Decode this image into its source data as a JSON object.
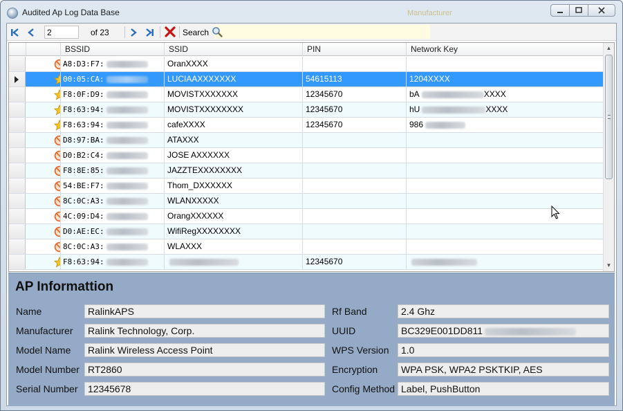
{
  "window": {
    "title": "Audited Ap Log Data Base",
    "ghost_title": "Manufacturer"
  },
  "toolbar": {
    "page_value": "2",
    "of_label": "of 23",
    "search_label": "Search"
  },
  "grid": {
    "columns": [
      "BSSID",
      "SSID",
      "PIN",
      "Network Key"
    ],
    "rows": [
      {
        "status": "blocked",
        "bssid": "A8:D3:F7:",
        "ssid": "OranXXXX",
        "pin": "",
        "key": "",
        "selected": false,
        "bssid_blur": 60,
        "ssid_blur": 0,
        "key_blur": 0
      },
      {
        "status": "star",
        "bssid": "00:05:CA:",
        "ssid": "LUCIAAXXXXXXX",
        "pin": "54615113",
        "key": "1204XXXX",
        "selected": true,
        "bssid_blur": 60,
        "ssid_blur": 0,
        "key_blur": 0
      },
      {
        "status": "star",
        "bssid": "F8:0F:D9:",
        "ssid": "MOVISTXXXXXXX",
        "pin": "12345670",
        "key": "XXXX",
        "key_prefix": "bA",
        "selected": false,
        "bssid_blur": 60,
        "ssid_blur": 0,
        "key_blur": 90
      },
      {
        "status": "star",
        "bssid": "F8:63:94:",
        "ssid": "MOVISTXXXXXXXX",
        "pin": "12345670",
        "key": "XXXX",
        "key_prefix": "hU",
        "selected": false,
        "bssid_blur": 60,
        "ssid_blur": 0,
        "key_blur": 92
      },
      {
        "status": "star",
        "bssid": "F8:63:94:",
        "ssid": "cafeXXXX",
        "pin": "12345670",
        "key": "",
        "key_prefix": "986",
        "selected": false,
        "bssid_blur": 60,
        "ssid_blur": 0,
        "key_blur": 58
      },
      {
        "status": "blocked",
        "bssid": "D8:97:BA:",
        "ssid": "ATAXXX",
        "pin": "",
        "key": "",
        "selected": false,
        "bssid_blur": 60,
        "ssid_blur": 0,
        "key_blur": 0
      },
      {
        "status": "blocked",
        "bssid": "D0:B2:C4:",
        "ssid": "JOSE AXXXXXX",
        "pin": "",
        "key": "",
        "selected": false,
        "bssid_blur": 60,
        "ssid_blur": 0,
        "key_blur": 0
      },
      {
        "status": "blocked",
        "bssid": "F8:8E:85:",
        "ssid": "JAZZTEXXXXXXXX",
        "pin": "",
        "key": "",
        "selected": false,
        "bssid_blur": 60,
        "ssid_blur": 0,
        "key_blur": 0
      },
      {
        "status": "blocked",
        "bssid": "54:BE:F7:",
        "ssid": "Thom_DXXXXXX",
        "pin": "",
        "key": "",
        "selected": false,
        "bssid_blur": 60,
        "ssid_blur": 0,
        "key_blur": 0
      },
      {
        "status": "blocked",
        "bssid": "8C:0C:A3:",
        "ssid": "WLANXXXXX",
        "pin": "",
        "key": "",
        "selected": false,
        "bssid_blur": 60,
        "ssid_blur": 0,
        "key_blur": 0
      },
      {
        "status": "blocked",
        "bssid": "4C:09:D4:",
        "ssid": "OrangXXXXXX",
        "pin": "",
        "key": "",
        "selected": false,
        "bssid_blur": 60,
        "ssid_blur": 0,
        "key_blur": 0
      },
      {
        "status": "blocked",
        "bssid": "D0:AE:EC:",
        "ssid": "WifiRegXXXXXXXX",
        "pin": "",
        "key": "",
        "selected": false,
        "bssid_blur": 60,
        "ssid_blur": 0,
        "key_blur": 0
      },
      {
        "status": "blocked",
        "bssid": "8C:0C:A3:",
        "ssid": "WLAXXX",
        "pin": "",
        "key": "",
        "selected": false,
        "bssid_blur": 60,
        "ssid_blur": 0,
        "key_blur": 0
      },
      {
        "status": "star",
        "bssid": "F8:63:94:",
        "ssid": "",
        "pin": "12345670",
        "key": "",
        "selected": false,
        "bssid_blur": 60,
        "ssid_blur": 100,
        "key_blur": 95
      }
    ]
  },
  "ap_info": {
    "title": "AP Informattion",
    "left": [
      {
        "label": "Name",
        "value": "RalinkAPS"
      },
      {
        "label": "Manufacturer",
        "value": "Ralink Technology, Corp."
      },
      {
        "label": "Model Name",
        "value": "Ralink Wireless Access Point"
      },
      {
        "label": "Model Number",
        "value": "RT2860"
      },
      {
        "label": "Serial Number",
        "value": "12345678"
      }
    ],
    "right": [
      {
        "label": "Rf Band",
        "value": "2.4 Ghz"
      },
      {
        "label": "UUID",
        "value": "BC329E001DD811"
      },
      {
        "label": "WPS Version",
        "value": "1.0"
      },
      {
        "label": "Encryption",
        "value": "WPA PSK, WPA2 PSKTKIP, AES"
      },
      {
        "label": "Config Method",
        "value": "Label, PushButton"
      }
    ]
  },
  "colors": {
    "selection": "#3399ff",
    "panel": "#95aac6",
    "alt_row": "#f0fbfd",
    "nav_blue": "#2c6fb8",
    "delete_red": "#cc1111"
  }
}
